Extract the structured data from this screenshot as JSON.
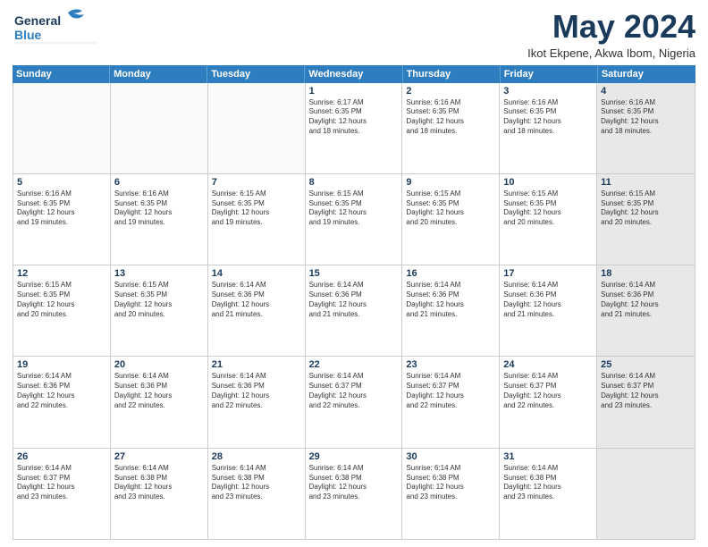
{
  "logo": {
    "line1": "General",
    "line2": "Blue"
  },
  "title": "May 2024",
  "location": "Ikot Ekpene, Akwa Ibom, Nigeria",
  "days_header": [
    "Sunday",
    "Monday",
    "Tuesday",
    "Wednesday",
    "Thursday",
    "Friday",
    "Saturday"
  ],
  "weeks": [
    [
      {
        "num": "",
        "info": "",
        "empty": true
      },
      {
        "num": "",
        "info": "",
        "empty": true
      },
      {
        "num": "",
        "info": "",
        "empty": true
      },
      {
        "num": "1",
        "info": "Sunrise: 6:17 AM\nSunset: 6:35 PM\nDaylight: 12 hours\nand 18 minutes."
      },
      {
        "num": "2",
        "info": "Sunrise: 6:16 AM\nSunset: 6:35 PM\nDaylight: 12 hours\nand 18 minutes."
      },
      {
        "num": "3",
        "info": "Sunrise: 6:16 AM\nSunset: 6:35 PM\nDaylight: 12 hours\nand 18 minutes."
      },
      {
        "num": "4",
        "info": "Sunrise: 6:16 AM\nSunset: 6:35 PM\nDaylight: 12 hours\nand 18 minutes.",
        "shaded": true
      }
    ],
    [
      {
        "num": "5",
        "info": "Sunrise: 6:16 AM\nSunset: 6:35 PM\nDaylight: 12 hours\nand 19 minutes."
      },
      {
        "num": "6",
        "info": "Sunrise: 6:16 AM\nSunset: 6:35 PM\nDaylight: 12 hours\nand 19 minutes."
      },
      {
        "num": "7",
        "info": "Sunrise: 6:15 AM\nSunset: 6:35 PM\nDaylight: 12 hours\nand 19 minutes."
      },
      {
        "num": "8",
        "info": "Sunrise: 6:15 AM\nSunset: 6:35 PM\nDaylight: 12 hours\nand 19 minutes."
      },
      {
        "num": "9",
        "info": "Sunrise: 6:15 AM\nSunset: 6:35 PM\nDaylight: 12 hours\nand 20 minutes."
      },
      {
        "num": "10",
        "info": "Sunrise: 6:15 AM\nSunset: 6:35 PM\nDaylight: 12 hours\nand 20 minutes."
      },
      {
        "num": "11",
        "info": "Sunrise: 6:15 AM\nSunset: 6:35 PM\nDaylight: 12 hours\nand 20 minutes.",
        "shaded": true
      }
    ],
    [
      {
        "num": "12",
        "info": "Sunrise: 6:15 AM\nSunset: 6:35 PM\nDaylight: 12 hours\nand 20 minutes."
      },
      {
        "num": "13",
        "info": "Sunrise: 6:15 AM\nSunset: 6:35 PM\nDaylight: 12 hours\nand 20 minutes."
      },
      {
        "num": "14",
        "info": "Sunrise: 6:14 AM\nSunset: 6:36 PM\nDaylight: 12 hours\nand 21 minutes."
      },
      {
        "num": "15",
        "info": "Sunrise: 6:14 AM\nSunset: 6:36 PM\nDaylight: 12 hours\nand 21 minutes."
      },
      {
        "num": "16",
        "info": "Sunrise: 6:14 AM\nSunset: 6:36 PM\nDaylight: 12 hours\nand 21 minutes."
      },
      {
        "num": "17",
        "info": "Sunrise: 6:14 AM\nSunset: 6:36 PM\nDaylight: 12 hours\nand 21 minutes."
      },
      {
        "num": "18",
        "info": "Sunrise: 6:14 AM\nSunset: 6:36 PM\nDaylight: 12 hours\nand 21 minutes.",
        "shaded": true
      }
    ],
    [
      {
        "num": "19",
        "info": "Sunrise: 6:14 AM\nSunset: 6:36 PM\nDaylight: 12 hours\nand 22 minutes."
      },
      {
        "num": "20",
        "info": "Sunrise: 6:14 AM\nSunset: 6:36 PM\nDaylight: 12 hours\nand 22 minutes."
      },
      {
        "num": "21",
        "info": "Sunrise: 6:14 AM\nSunset: 6:36 PM\nDaylight: 12 hours\nand 22 minutes."
      },
      {
        "num": "22",
        "info": "Sunrise: 6:14 AM\nSunset: 6:37 PM\nDaylight: 12 hours\nand 22 minutes."
      },
      {
        "num": "23",
        "info": "Sunrise: 6:14 AM\nSunset: 6:37 PM\nDaylight: 12 hours\nand 22 minutes."
      },
      {
        "num": "24",
        "info": "Sunrise: 6:14 AM\nSunset: 6:37 PM\nDaylight: 12 hours\nand 22 minutes."
      },
      {
        "num": "25",
        "info": "Sunrise: 6:14 AM\nSunset: 6:37 PM\nDaylight: 12 hours\nand 23 minutes.",
        "shaded": true
      }
    ],
    [
      {
        "num": "26",
        "info": "Sunrise: 6:14 AM\nSunset: 6:37 PM\nDaylight: 12 hours\nand 23 minutes."
      },
      {
        "num": "27",
        "info": "Sunrise: 6:14 AM\nSunset: 6:38 PM\nDaylight: 12 hours\nand 23 minutes."
      },
      {
        "num": "28",
        "info": "Sunrise: 6:14 AM\nSunset: 6:38 PM\nDaylight: 12 hours\nand 23 minutes."
      },
      {
        "num": "29",
        "info": "Sunrise: 6:14 AM\nSunset: 6:38 PM\nDaylight: 12 hours\nand 23 minutes."
      },
      {
        "num": "30",
        "info": "Sunrise: 6:14 AM\nSunset: 6:38 PM\nDaylight: 12 hours\nand 23 minutes."
      },
      {
        "num": "31",
        "info": "Sunrise: 6:14 AM\nSunset: 6:38 PM\nDaylight: 12 hours\nand 23 minutes."
      },
      {
        "num": "",
        "info": "",
        "empty": true,
        "shaded": true
      }
    ]
  ]
}
